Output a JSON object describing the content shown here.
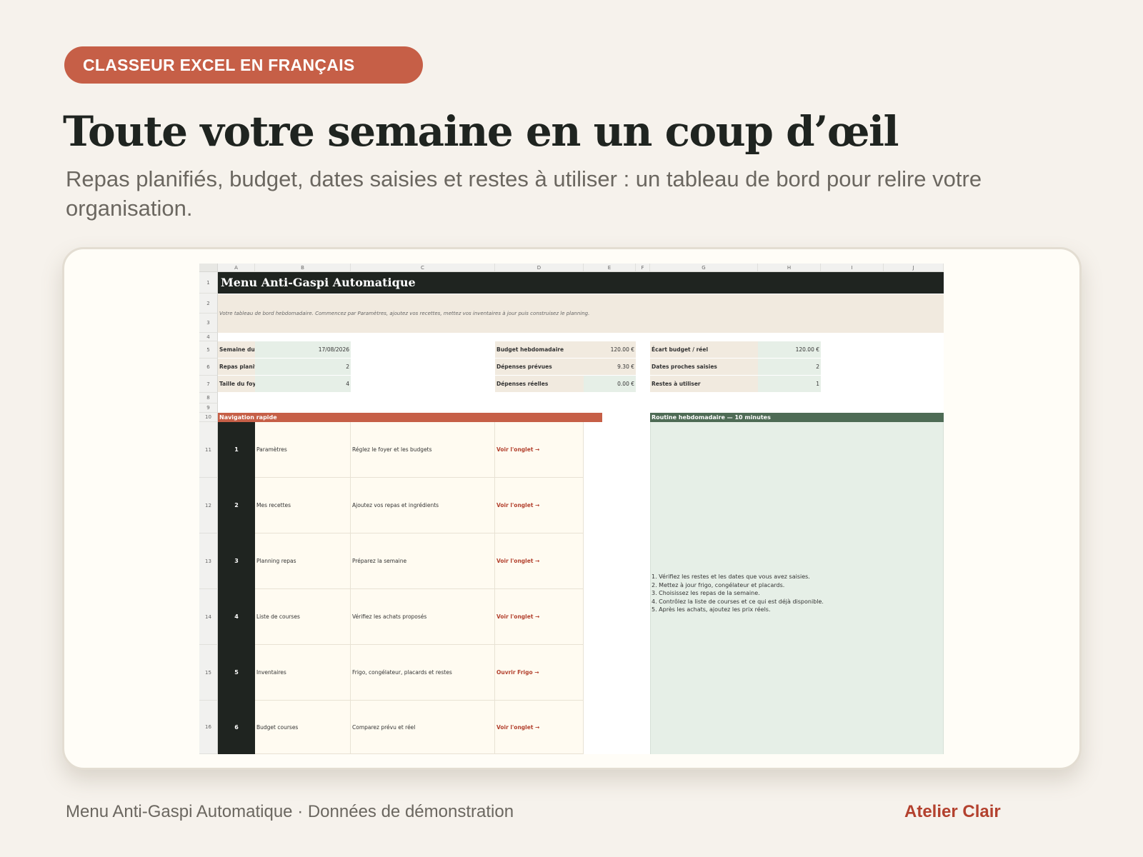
{
  "badge": "CLASSEUR EXCEL EN FRANÇAIS",
  "headline": "Toute votre semaine en un coup d’œil",
  "subtitle": "Repas planifiés, budget, dates saisies et restes à utiliser : un tableau de bord pour relire votre organisation.",
  "sheet": {
    "columns": [
      "A",
      "B",
      "C",
      "D",
      "E",
      "F",
      "G",
      "H",
      "I",
      "J"
    ],
    "rows": [
      "1",
      "2",
      "3",
      "4",
      "5",
      "6",
      "7",
      "8",
      "9",
      "10",
      "11",
      "12",
      "13",
      "14",
      "15",
      "16"
    ],
    "title": "Menu Anti-Gaspi Automatique",
    "intro": "Votre tableau de bord hebdomadaire. Commencez par Paramètres, ajoutez vos recettes, mettez vos inventaires à jour puis construisez le planning.",
    "kpi_left": [
      {
        "label": "Semaine du",
        "value": "17/08/2026"
      },
      {
        "label": "Repas planifié",
        "value": "2"
      },
      {
        "label": "Taille du foyer",
        "value": "4"
      }
    ],
    "kpi_mid": [
      {
        "label": "Budget hebdomadaire",
        "value": "120.00 €"
      },
      {
        "label": "Dépenses prévues",
        "value": "9.30 €"
      },
      {
        "label": "Dépenses réelles",
        "value": "0.00 €"
      }
    ],
    "kpi_right": [
      {
        "label": "Écart budget / réel",
        "value": "120.00 €"
      },
      {
        "label": "Dates proches saisies",
        "value": "2"
      },
      {
        "label": "Restes à utiliser",
        "value": "1"
      }
    ],
    "nav_header": "Navigation rapide",
    "nav": [
      {
        "num": "1",
        "name": "Paramètres",
        "desc": "Réglez le foyer et les budgets",
        "link": "Voir l'onglet →"
      },
      {
        "num": "2",
        "name": "Mes recettes",
        "desc": "Ajoutez vos repas et ingrédients",
        "link": "Voir l'onglet →"
      },
      {
        "num": "3",
        "name": "Planning repas",
        "desc": "Préparez la semaine",
        "link": "Voir l'onglet →"
      },
      {
        "num": "4",
        "name": "Liste de courses",
        "desc": "Vérifiez les achats proposés",
        "link": "Voir l'onglet →"
      },
      {
        "num": "5",
        "name": "Inventaires",
        "desc": "Frigo, congélateur, placards et restes",
        "link": "Ouvrir Frigo →"
      },
      {
        "num": "6",
        "name": "Budget courses",
        "desc": "Comparez prévu et réel",
        "link": "Voir l'onglet →"
      }
    ],
    "routine_header": "Routine hebdomadaire — 10 minutes",
    "routine": [
      "1. Vérifiez les restes et les dates que vous avez saisies.",
      "2. Mettez à jour frigo, congélateur et placards.",
      "3. Choisissez les repas de la semaine.",
      "4. Contrôlez la liste de courses et ce qui est déjà disponible.",
      "5. Après les achats, ajoutez les prix réels."
    ]
  },
  "footer": {
    "left": "Menu Anti-Gaspi Automatique · Données de démonstration",
    "right": "Atelier Clair"
  }
}
